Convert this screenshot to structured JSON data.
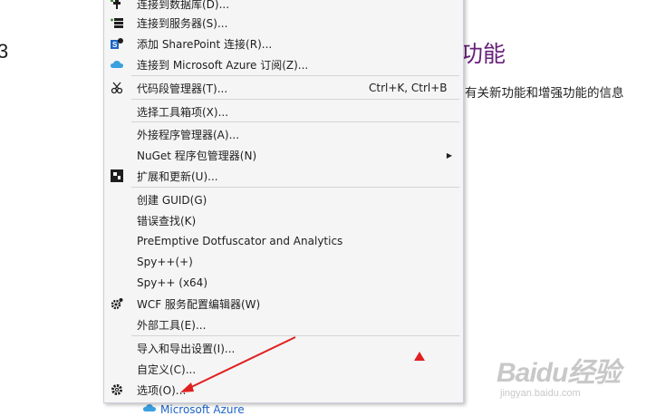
{
  "background": {
    "number": "3",
    "heading": "功能",
    "body_text": "有关新功能和增强功能的信息",
    "azure_link": "Microsoft Azure"
  },
  "menu": {
    "items": [
      {
        "label": "连接到数据库(D)...",
        "icon": "database-plug-icon"
      },
      {
        "label": "连接到服务器(S)...",
        "icon": "server-connect-icon"
      },
      {
        "label": "添加 SharePoint 连接(R)...",
        "icon": "sharepoint-icon"
      },
      {
        "label": "连接到 Microsoft Azure 订阅(Z)...",
        "icon": "azure-cloud-icon"
      },
      {
        "label": "代码段管理器(T)...",
        "shortcut": "Ctrl+K, Ctrl+B",
        "icon": "snippet-icon"
      },
      {
        "label": "选择工具箱项(X)..."
      },
      {
        "label": "外接程序管理器(A)..."
      },
      {
        "label": "NuGet 程序包管理器(N)",
        "has_submenu": true
      },
      {
        "label": "扩展和更新(U)...",
        "icon": "extensions-icon"
      },
      {
        "label": "创建 GUID(G)"
      },
      {
        "label": "错误查找(K)"
      },
      {
        "label": "PreEmptive Dotfuscator and Analytics"
      },
      {
        "label": "Spy++(+)"
      },
      {
        "label": "Spy++ (x64)"
      },
      {
        "label": "WCF 服务配置编辑器(W)",
        "icon": "wcf-gear-icon"
      },
      {
        "label": "外部工具(E)..."
      },
      {
        "label": "导入和导出设置(I)..."
      },
      {
        "label": "自定义(C)..."
      },
      {
        "label": "选项(O)...",
        "icon": "gear-icon"
      }
    ]
  },
  "watermark": {
    "main": "Baidu经验",
    "sub": "jingyan.baidu.com"
  },
  "colors": {
    "menu_bg": "#f5f5f5",
    "heading_purple": "#68217a",
    "annotation_red": "#e02020",
    "link_blue": "#1e64c8"
  }
}
